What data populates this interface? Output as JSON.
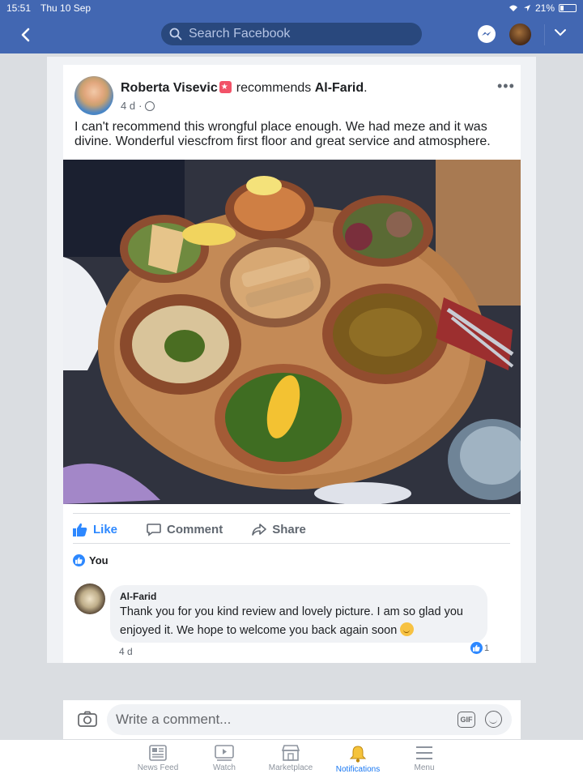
{
  "status_bar": {
    "time": "15:51",
    "date": "Thu 10 Sep",
    "battery": "21%"
  },
  "nav": {
    "search_placeholder": "Search Facebook"
  },
  "post": {
    "author": "Roberta Visevic",
    "verb": "recommends",
    "page": "Al-Farid",
    "time": "4 d",
    "text": "I can't recommend this wrongful place enough.  We had meze and it was divine. Wonderful viescfrom first floor and great service and atmosphere.",
    "actions": {
      "like": "Like",
      "comment": "Comment",
      "share": "Share"
    },
    "reactions_label": "You"
  },
  "comment": {
    "author": "Al-Farid",
    "text": "Thank you for you kind review and lovely picture. I am so glad you enjoyed it. We hope to welcome you back again soon",
    "time": "4 d",
    "like_count": "1"
  },
  "composer": {
    "placeholder": "Write a comment...",
    "gif_label": "GIF"
  },
  "tabs": [
    {
      "label": "News Feed",
      "icon": "news-feed-icon"
    },
    {
      "label": "Watch",
      "icon": "watch-icon"
    },
    {
      "label": "Marketplace",
      "icon": "marketplace-icon"
    },
    {
      "label": "Notifications",
      "icon": "bell-icon",
      "active": true
    },
    {
      "label": "Menu",
      "icon": "menu-icon"
    }
  ],
  "colors": {
    "brand": "#4267b2",
    "like_blue": "#2d88ff",
    "active_tab": "#1877f2"
  }
}
